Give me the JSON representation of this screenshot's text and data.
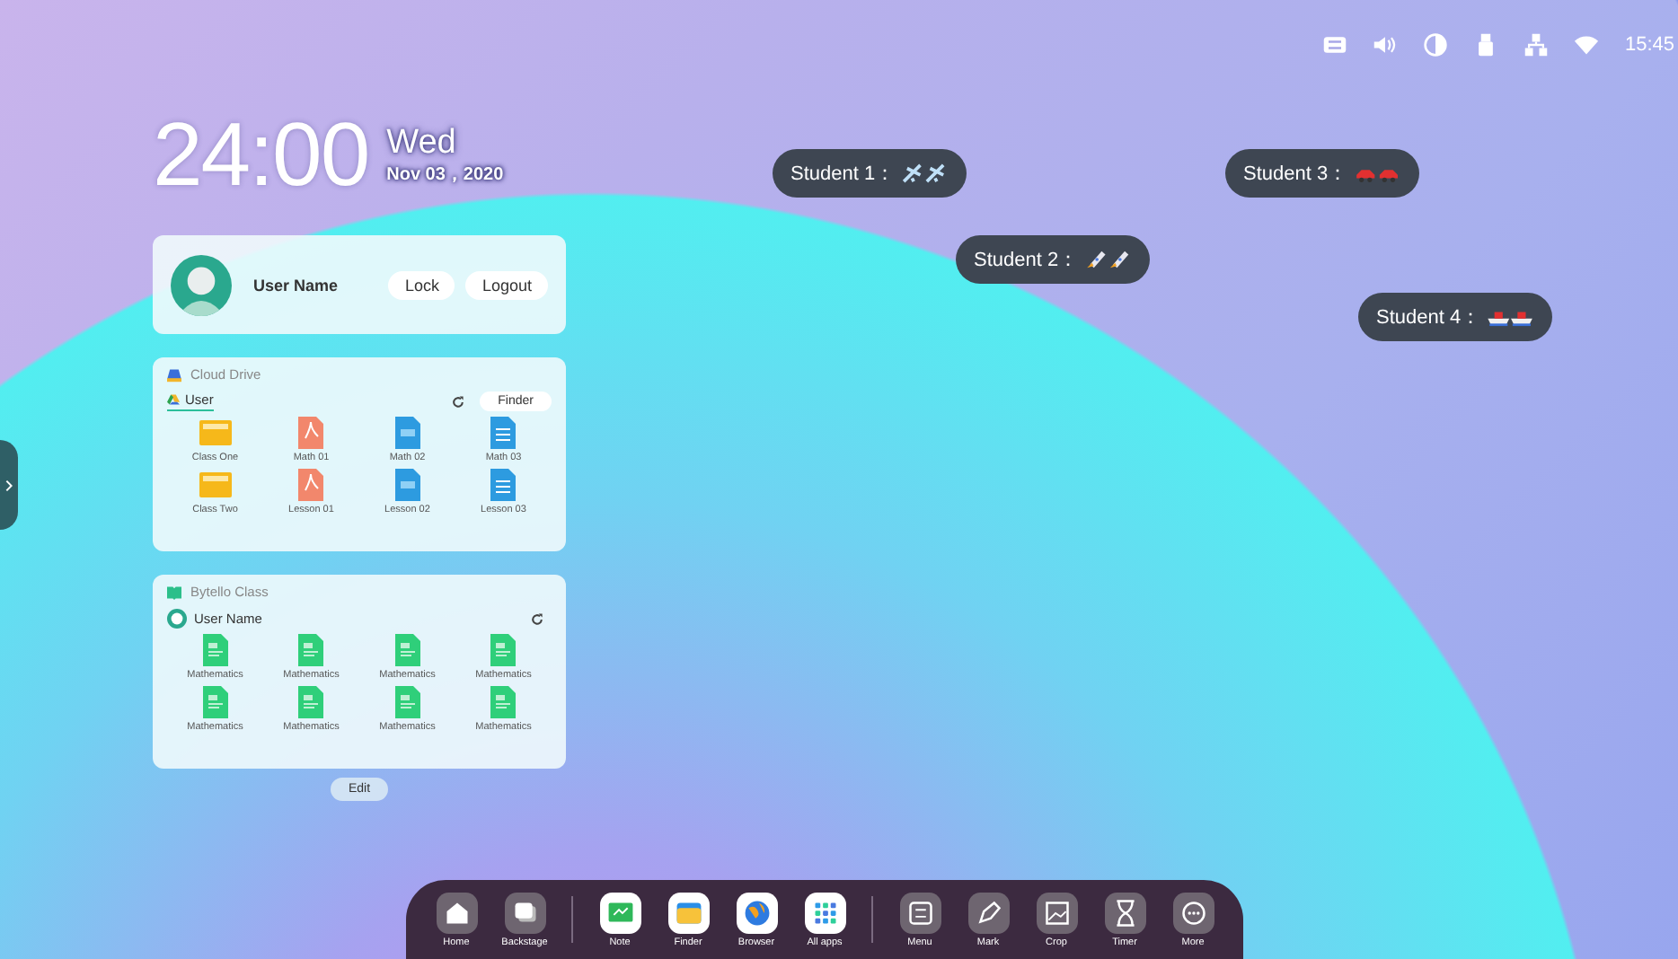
{
  "status_bar": {
    "time": "15:45"
  },
  "clock": {
    "time": "24:00",
    "weekday": "Wed",
    "date": "Nov 03，2020"
  },
  "user_card": {
    "name": "User Name",
    "buttons": [
      "Lock",
      "Logout"
    ]
  },
  "cloud_drive": {
    "title": "Cloud Drive",
    "tab": {
      "label": "User",
      "selected": true
    },
    "finder_button": "Finder",
    "files": [
      {
        "name": "Class One",
        "kind": "folder"
      },
      {
        "name": "Math 01",
        "kind": "pdf"
      },
      {
        "name": "Math 02",
        "kind": "doc"
      },
      {
        "name": "Math 03",
        "kind": "text"
      },
      {
        "name": "Class Two",
        "kind": "folder"
      },
      {
        "name": "Lesson 01",
        "kind": "pdf"
      },
      {
        "name": "Lesson 02",
        "kind": "doc"
      },
      {
        "name": "Lesson 03",
        "kind": "text"
      }
    ]
  },
  "class_panel": {
    "title": "Bytello Class",
    "user": "User Name",
    "files": [
      {
        "name": "Mathematics",
        "kind": "sheet"
      },
      {
        "name": "Mathematics",
        "kind": "sheet"
      },
      {
        "name": "Mathematics",
        "kind": "sheet"
      },
      {
        "name": "Mathematics",
        "kind": "sheet"
      },
      {
        "name": "Mathematics",
        "kind": "sheet"
      },
      {
        "name": "Mathematics",
        "kind": "sheet"
      },
      {
        "name": "Mathematics",
        "kind": "sheet"
      },
      {
        "name": "Mathematics",
        "kind": "sheet"
      }
    ]
  },
  "edit_button": "Edit",
  "students": [
    {
      "label": "Student 1：",
      "kind": "plane"
    },
    {
      "label": "Student 2：",
      "kind": "rocket"
    },
    {
      "label": "Student 3：",
      "kind": "car"
    },
    {
      "label": "Student 4：",
      "kind": "ship"
    }
  ],
  "dock": {
    "groups": [
      [
        {
          "label": "Home",
          "kind": "home"
        },
        {
          "label": "Backstage",
          "kind": "backstage"
        }
      ],
      [
        {
          "label": "Note",
          "kind": "note"
        },
        {
          "label": "Finder",
          "kind": "finder"
        },
        {
          "label": "Browser",
          "kind": "browser"
        },
        {
          "label": "All apps",
          "kind": "apps"
        }
      ],
      [
        {
          "label": "Menu",
          "kind": "menu"
        },
        {
          "label": "Mark",
          "kind": "mark"
        },
        {
          "label": "Crop",
          "kind": "crop"
        },
        {
          "label": "Timer",
          "kind": "timer"
        },
        {
          "label": "More",
          "kind": "more"
        }
      ]
    ]
  }
}
